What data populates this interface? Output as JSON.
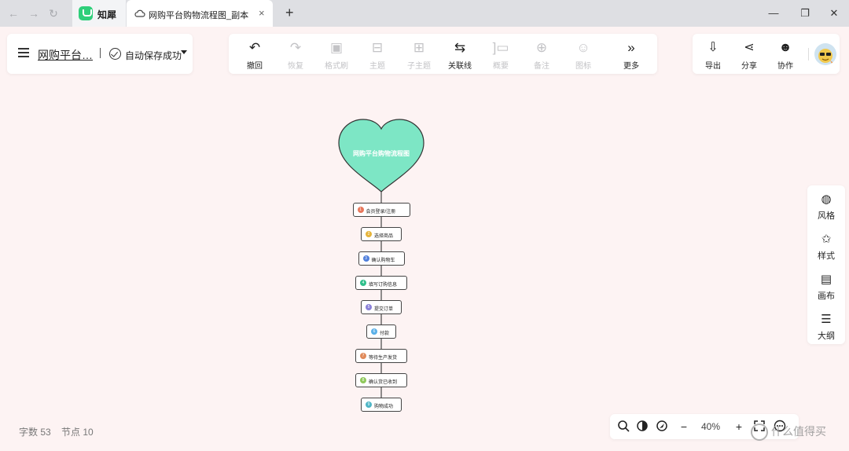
{
  "titlebar": {
    "app_name": "知犀",
    "tab_title": "网购平台购物流程图_副本",
    "back_icon": "arrow-left-icon",
    "forward_icon": "arrow-right-icon",
    "reload_icon": "reload-icon",
    "tab_close": "×",
    "tab_add": "+",
    "minimize": "—",
    "restore": "❐",
    "close": "✕"
  },
  "header": {
    "doc_title": "网购平台…",
    "save_status": "自动保存成功"
  },
  "toolbar": {
    "items": [
      {
        "label": "撤回",
        "icon": "undo-icon",
        "glyph": "↶",
        "enabled": true
      },
      {
        "label": "恢复",
        "icon": "redo-icon",
        "glyph": "↷",
        "enabled": false
      },
      {
        "label": "格式刷",
        "icon": "format-brush-icon",
        "glyph": "▣",
        "enabled": false
      },
      {
        "label": "主题",
        "icon": "topic-icon",
        "glyph": "⊟",
        "enabled": false
      },
      {
        "label": "子主题",
        "icon": "subtopic-icon",
        "glyph": "⊞",
        "enabled": false
      },
      {
        "label": "关联线",
        "icon": "relation-line-icon",
        "glyph": "⇆",
        "enabled": true
      },
      {
        "label": "概要",
        "icon": "summary-icon",
        "glyph": "]▭",
        "enabled": false
      },
      {
        "label": "备注",
        "icon": "note-icon",
        "glyph": "⊕",
        "enabled": false
      },
      {
        "label": "图标",
        "icon": "emoji-icon",
        "glyph": "☺",
        "enabled": false
      },
      {
        "label": "更多",
        "icon": "more-icon",
        "glyph": "»",
        "enabled": true
      }
    ]
  },
  "right_toolbar": {
    "items": [
      {
        "label": "导出",
        "icon": "export-icon",
        "glyph": "⇩"
      },
      {
        "label": "分享",
        "icon": "share-icon",
        "glyph": "⋖"
      },
      {
        "label": "协作",
        "icon": "collaborate-icon",
        "glyph": "☻"
      }
    ]
  },
  "side_panel": {
    "items": [
      {
        "label": "风格",
        "icon": "palette-icon",
        "glyph": "◍"
      },
      {
        "label": "样式",
        "icon": "style-icon",
        "glyph": "✩"
      },
      {
        "label": "画布",
        "icon": "canvas-icon",
        "glyph": "▤"
      },
      {
        "label": "大纲",
        "icon": "outline-icon",
        "glyph": "☰"
      }
    ]
  },
  "mindmap": {
    "root": "网购平台购物流程图",
    "root_color": "#7de6c5",
    "nodes": [
      {
        "num": "1",
        "text": "会员登录/注册",
        "color": "#e8775b"
      },
      {
        "num": "2",
        "text": "选择商品",
        "color": "#e6b43a"
      },
      {
        "num": "3",
        "text": "确认购物车",
        "color": "#4f7fdc"
      },
      {
        "num": "4",
        "text": "填写订购信息",
        "color": "#2fbf8b"
      },
      {
        "num": "5",
        "text": "提交订单",
        "color": "#8a80d8"
      },
      {
        "num": "6",
        "text": "付款",
        "color": "#5ab0e8"
      },
      {
        "num": "7",
        "text": "等待生产发货",
        "color": "#e08a5a"
      },
      {
        "num": "8",
        "text": "确认货已收到",
        "color": "#8fc85a"
      },
      {
        "num": "9",
        "text": "购物成功",
        "color": "#4fb6c6"
      }
    ]
  },
  "status": {
    "word_count": "字数 53",
    "node_count": "节点 10"
  },
  "zoom": {
    "level": "40%"
  },
  "watermark": "什么值得买"
}
